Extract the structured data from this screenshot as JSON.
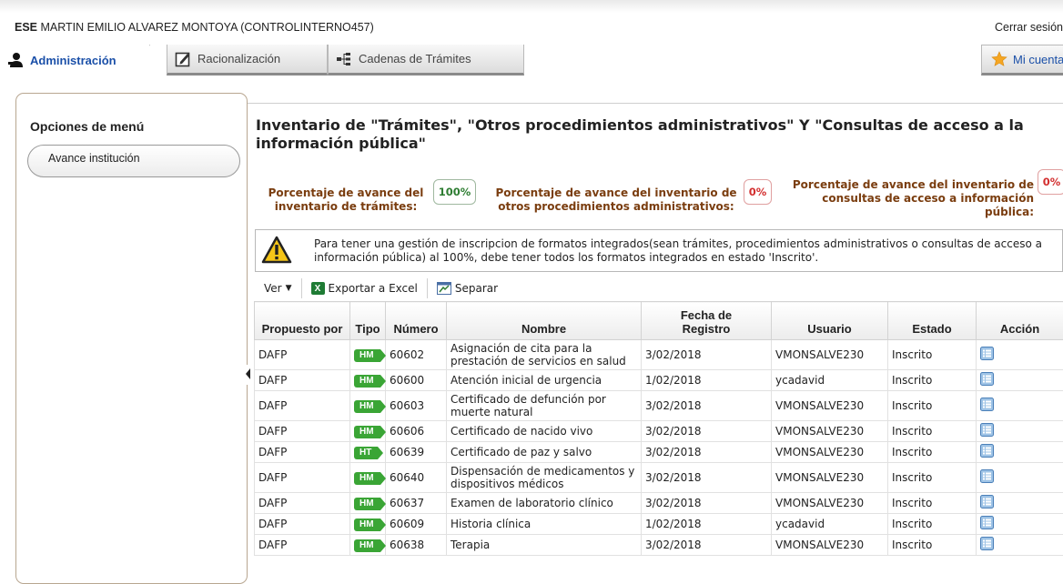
{
  "header": {
    "user_bold": "ESE",
    "user_rest": " MARTIN EMILIO ALVAREZ MONTOYA (CONTROLINTERNO457)",
    "logout_label": "Cerrar sesión"
  },
  "tabs": [
    {
      "label": "Administración",
      "active": true,
      "icon": "admin-user-icon"
    },
    {
      "label": "Racionalización",
      "active": false,
      "icon": "edit-icon"
    },
    {
      "label": "Cadenas de Trámites",
      "active": false,
      "icon": "chain-icon"
    }
  ],
  "account_button": {
    "label": "Mi cuenta",
    "icon": "star-icon"
  },
  "sidebar": {
    "title": "Opciones de menú",
    "items": [
      {
        "label": "Avance institución"
      }
    ]
  },
  "main": {
    "title": "Inventario de \"Trámites\", \"Otros procedimientos administrativos\" Y \"Consultas de acceso a la información pública\"",
    "stats": [
      {
        "label": "Porcentaje de avance del inventario de trámites:",
        "value": "100%",
        "color": "#2e7d32"
      },
      {
        "label": "Porcentaje de avance del inventario de otros procedimientos administrativos:",
        "value": "0%",
        "color": "#d32f2f"
      },
      {
        "label": "Porcentaje de avance del inventario de consultas de acceso a información pública:",
        "value": "0%",
        "color": "#d32f2f"
      }
    ],
    "warning": "Para tener una gestión de inscripcion de formatos integrados(sean trámites, procedimientos administrativos o consultas de acceso a información pública) al 100%, debe tener todos los formatos integrados en estado 'Inscrito'.",
    "toolbar": {
      "view_label": "Ver",
      "export_label": "Exportar a Excel",
      "split_label": "Separar"
    },
    "table": {
      "headers": {
        "proposed": "Propuesto por",
        "type": "Tipo",
        "number": "Número",
        "name": "Nombre",
        "date_line1": "Fecha de",
        "date_line2": "Registro",
        "user": "Usuario",
        "status": "Estado",
        "action": "Acción"
      },
      "rows": [
        {
          "proposed": "DAFP",
          "type": "HM",
          "number": "60602",
          "name": "Asignación de cita para la prestación de servicios en salud",
          "date": "3/02/2018",
          "user": "VMONSALVE230",
          "status": "Inscrito"
        },
        {
          "proposed": "DAFP",
          "type": "HM",
          "number": "60600",
          "name": "Atención inicial de urgencia",
          "date": "1/02/2018",
          "user": "ycadavid",
          "status": "Inscrito"
        },
        {
          "proposed": "DAFP",
          "type": "HM",
          "number": "60603",
          "name": "Certificado de defunción por muerte natural",
          "date": "3/02/2018",
          "user": "VMONSALVE230",
          "status": "Inscrito"
        },
        {
          "proposed": "DAFP",
          "type": "HM",
          "number": "60606",
          "name": "Certificado de nacido vivo",
          "date": "3/02/2018",
          "user": "VMONSALVE230",
          "status": "Inscrito"
        },
        {
          "proposed": "DAFP",
          "type": "HT",
          "number": "60639",
          "name": "Certificado de paz y salvo",
          "date": "3/02/2018",
          "user": "VMONSALVE230",
          "status": "Inscrito"
        },
        {
          "proposed": "DAFP",
          "type": "HM",
          "number": "60640",
          "name": "Dispensación de medicamentos y dispositivos médicos",
          "date": "3/02/2018",
          "user": "VMONSALVE230",
          "status": "Inscrito"
        },
        {
          "proposed": "DAFP",
          "type": "HM",
          "number": "60637",
          "name": "Examen de laboratorio clínico",
          "date": "3/02/2018",
          "user": "VMONSALVE230",
          "status": "Inscrito"
        },
        {
          "proposed": "DAFP",
          "type": "HM",
          "number": "60609",
          "name": "Historia clínica",
          "date": "1/02/2018",
          "user": "ycadavid",
          "status": "Inscrito"
        },
        {
          "proposed": "DAFP",
          "type": "HM",
          "number": "60638",
          "name": "Terapia",
          "date": "3/02/2018",
          "user": "VMONSALVE230",
          "status": "Inscrito"
        }
      ]
    }
  }
}
